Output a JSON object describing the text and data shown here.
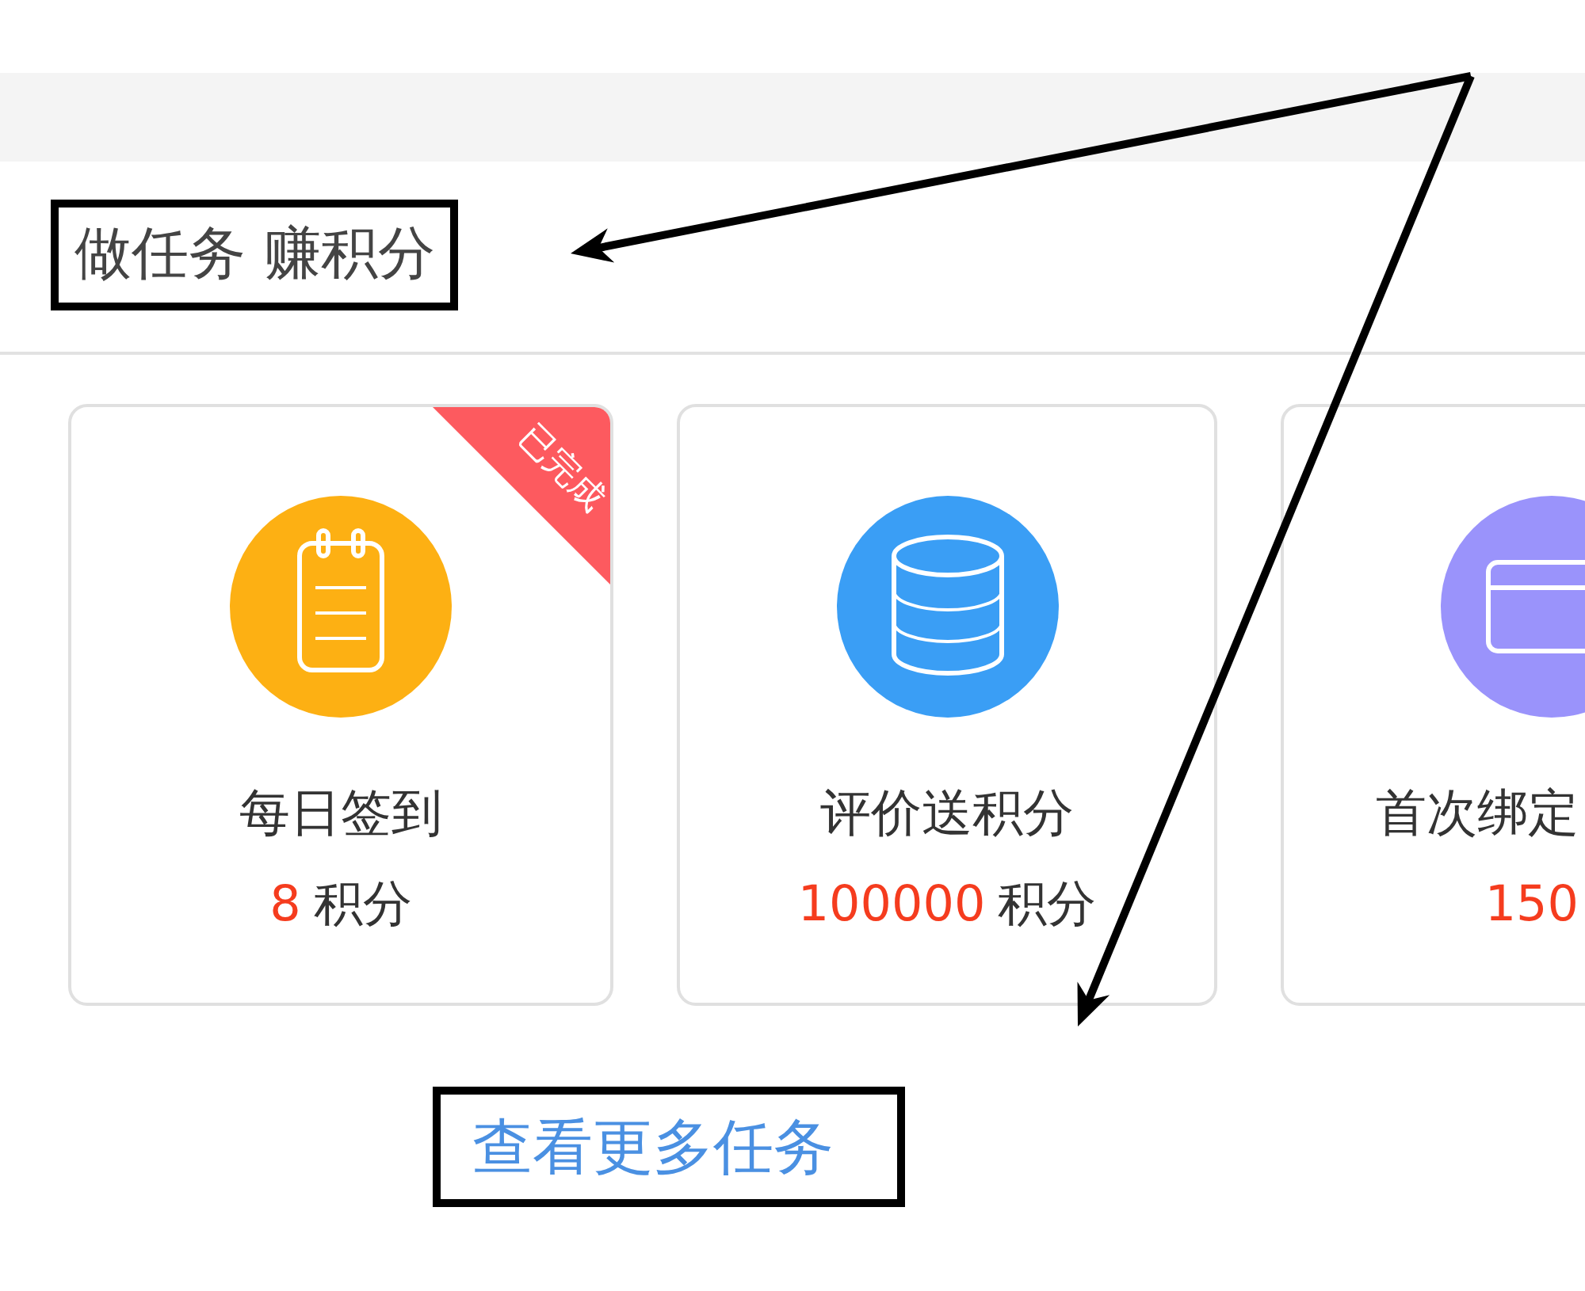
{
  "heading": {
    "text": "做任务 赚积分",
    "outlined": true,
    "arrow": true
  },
  "tasks": [
    {
      "kind": "notepad",
      "color": "#fdb013",
      "title": "每日签到",
      "points": "8",
      "unit": "积分",
      "badge": "已完成"
    },
    {
      "kind": "database",
      "color": "#3a9ef5",
      "title": "评价送积分",
      "points": "100000",
      "unit": "积分"
    },
    {
      "kind": "card",
      "color": "#9a93fb",
      "title": "首次绑定",
      "points": "150"
    }
  ],
  "more_link": {
    "text": "查看更多任务",
    "outlined": true,
    "arrow": true
  }
}
